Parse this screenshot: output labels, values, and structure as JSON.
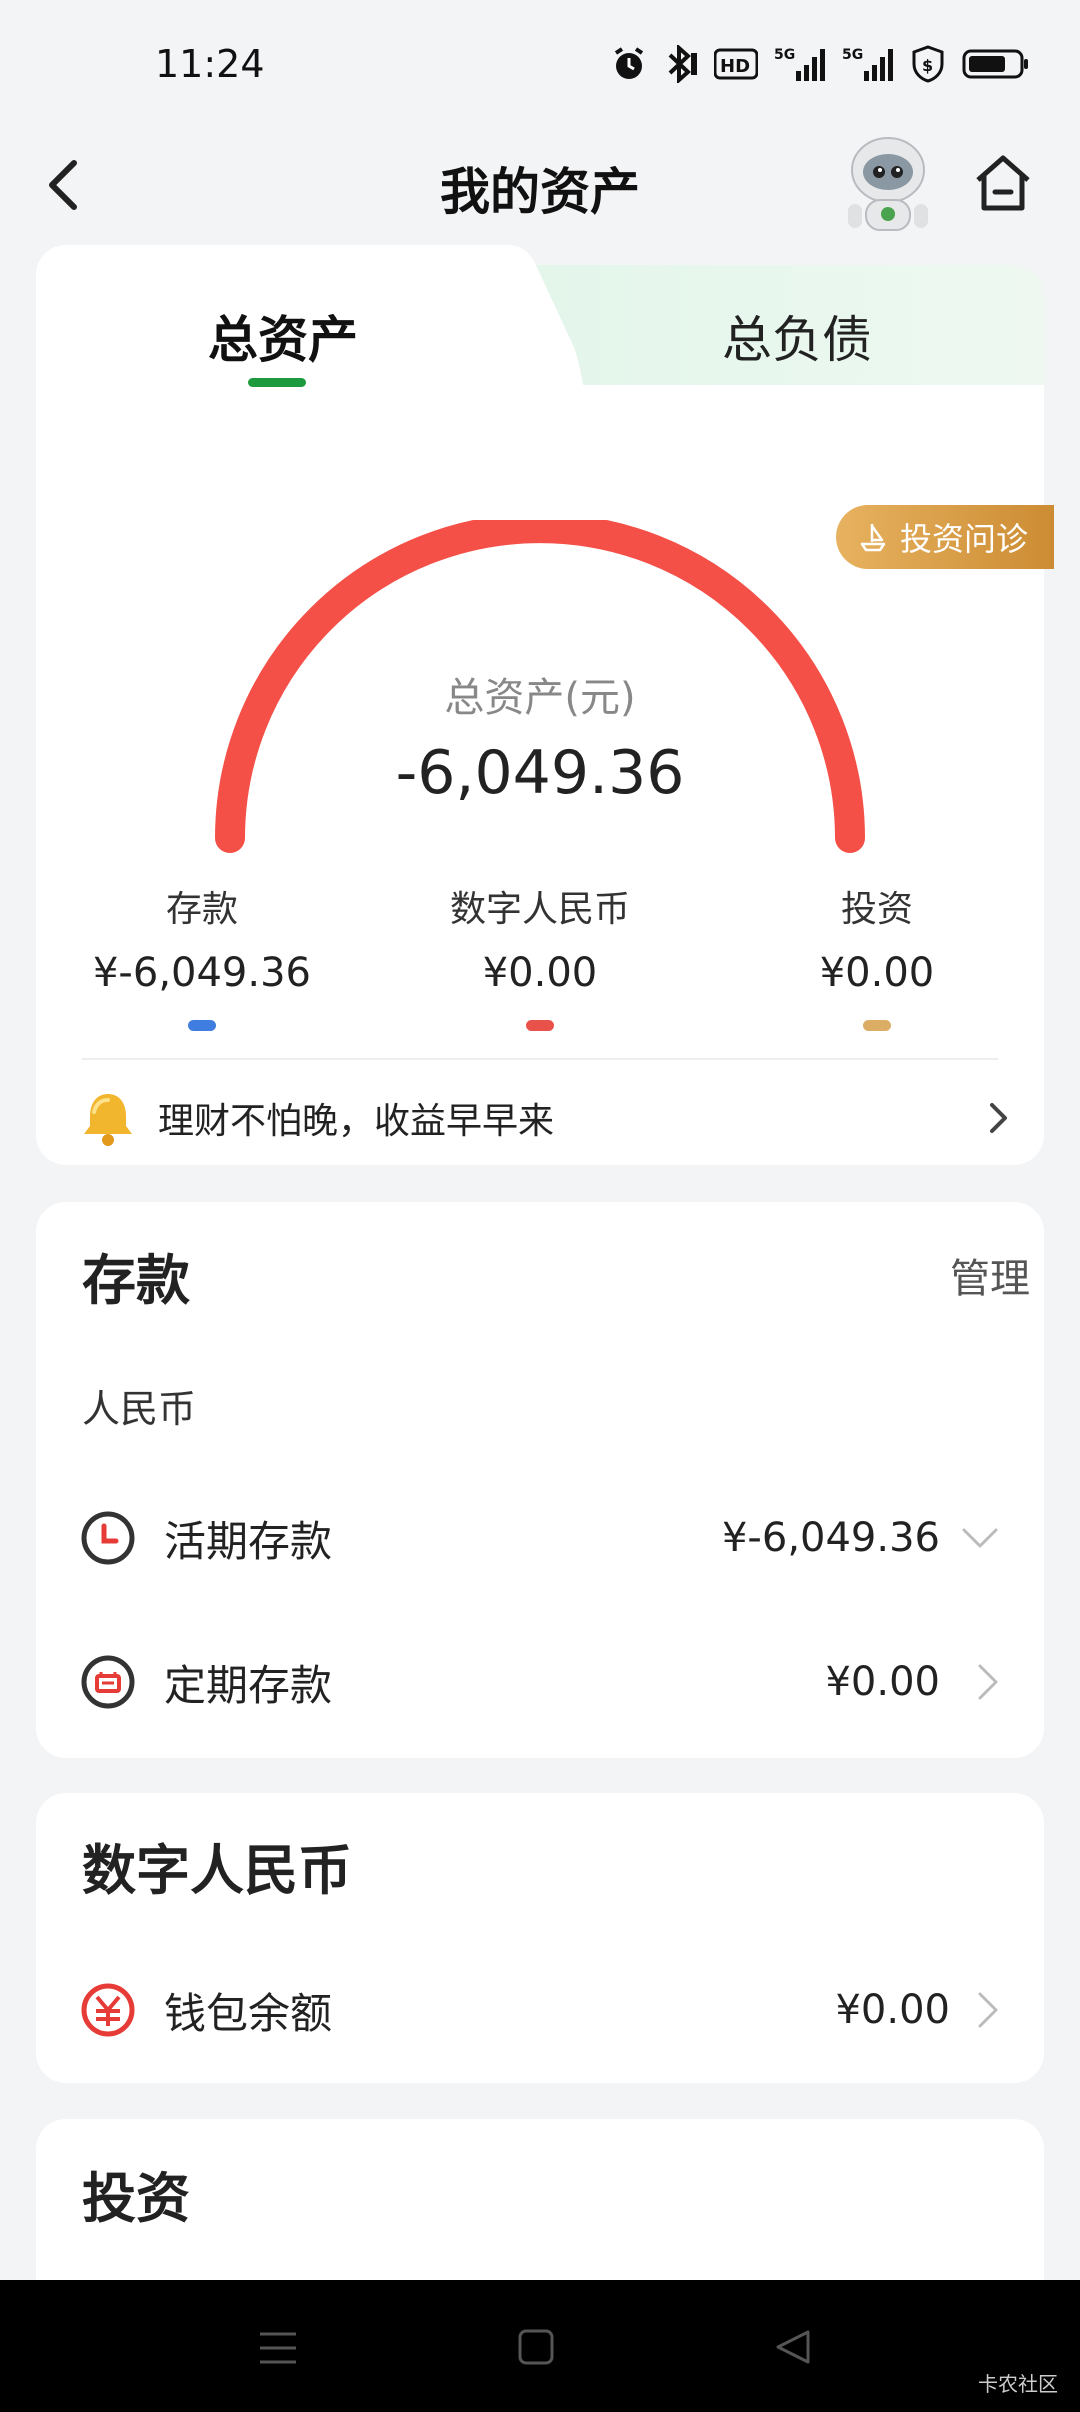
{
  "status": {
    "time": "11:24"
  },
  "nav": {
    "title": "我的资产",
    "back_icon": "chevron-left-icon",
    "assistant_icon": "robot-assistant-icon",
    "home_icon": "home-icon"
  },
  "tabs": {
    "active": "总资产",
    "inactive": "总负债"
  },
  "summary": {
    "badge": "投资问诊",
    "gauge_label": "总资产(元)",
    "total": "-6,049.36",
    "gauge_color": "#f45047",
    "categories": [
      {
        "name": "存款",
        "amount": "¥-6,049.36",
        "color": "#3f7de0"
      },
      {
        "name": "数字人民币",
        "amount": "¥0.00",
        "color": "#e9514b"
      },
      {
        "name": "投资",
        "amount": "¥0.00",
        "color": "#dcae65"
      }
    ],
    "promo": "理财不怕晚，收益早早来"
  },
  "deposit": {
    "title": "存款",
    "manage": "管理",
    "currency": "人民币",
    "rows": [
      {
        "label": "活期存款",
        "value": "¥-6,049.36"
      },
      {
        "label": "定期存款",
        "value": "¥0.00"
      }
    ]
  },
  "drmb": {
    "title": "数字人民币",
    "row": {
      "label": "钱包余额",
      "value": "¥0.00"
    }
  },
  "invest": {
    "title": "投资"
  },
  "watermark": "卡农社区"
}
